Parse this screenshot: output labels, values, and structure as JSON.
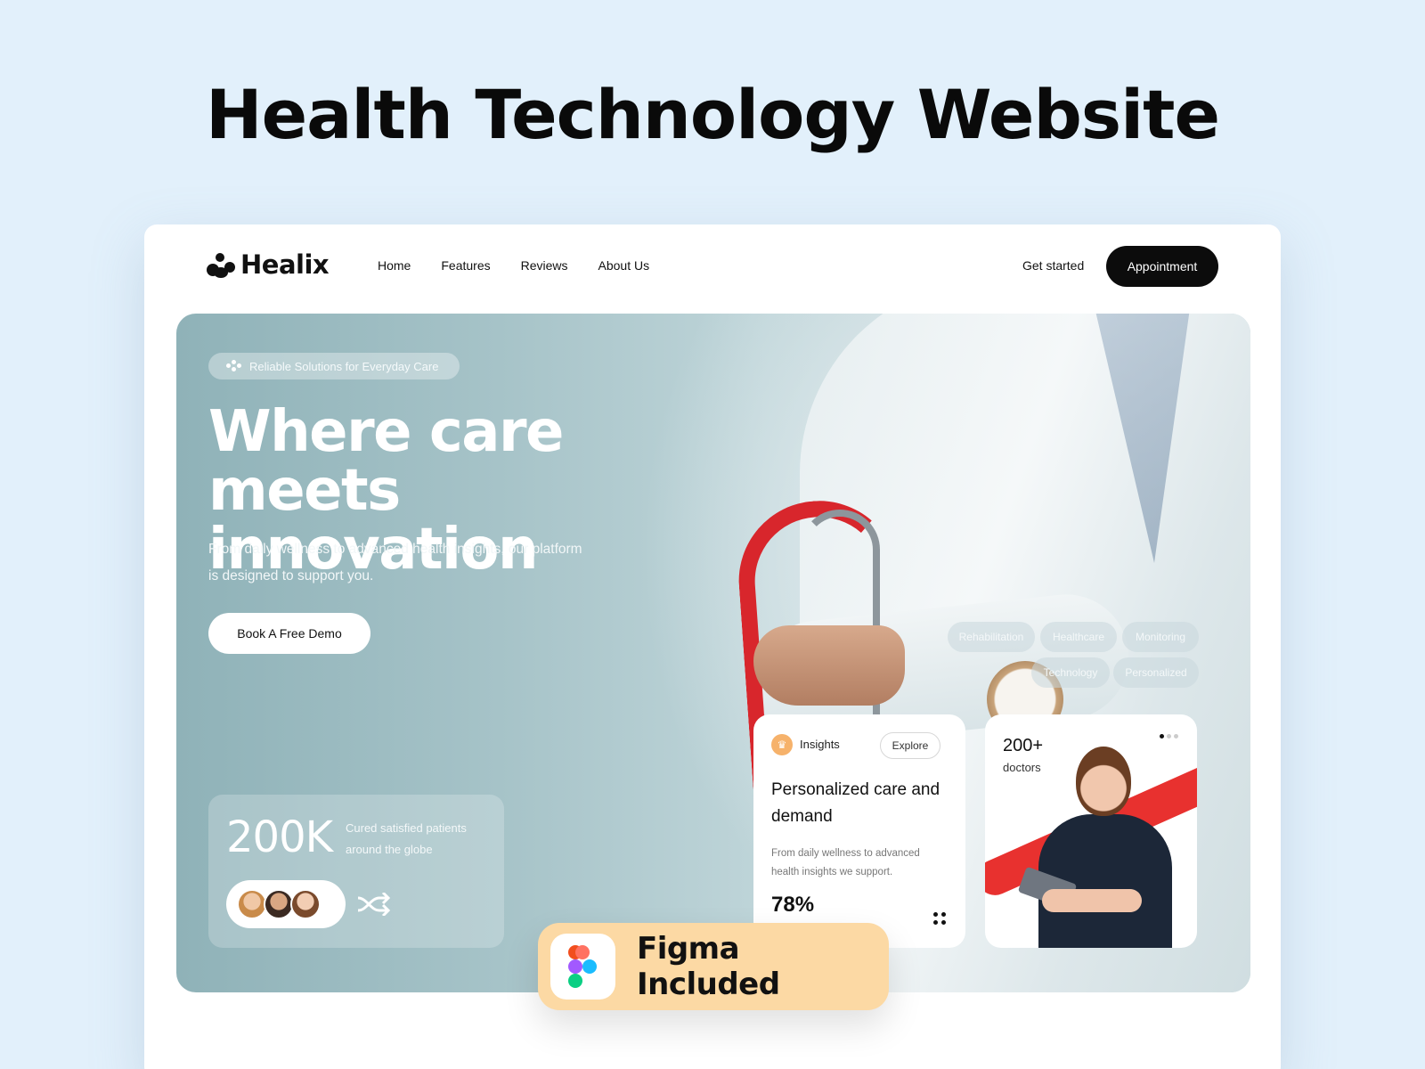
{
  "page": {
    "heading": "Health Technology Website"
  },
  "nav": {
    "brand": "Healix",
    "links": [
      "Home",
      "Features",
      "Reviews",
      "About Us"
    ],
    "get_started": "Get started",
    "appointment": "Appointment"
  },
  "hero": {
    "tagline": "Reliable Solutions for Everyday Care",
    "title_line1": "Where care",
    "title_line2": "meets innovation",
    "subtitle": "From daily wellness to advanced health insights, our platform is designed to support you.",
    "cta": "Book A Free Demo"
  },
  "stats": {
    "value": "200K",
    "description": "Cured satisfied patients around the globe"
  },
  "tags": [
    "Rehabilitation",
    "Healthcare",
    "Monitoring",
    "Technology",
    "Personalized"
  ],
  "insights_card": {
    "label": "Insights",
    "explore": "Explore",
    "title": "Personalized care and demand",
    "text": "From daily wellness to advanced health insights we support.",
    "percent": "78%"
  },
  "doctors_card": {
    "count": "200+",
    "label": "doctors"
  },
  "badge": {
    "text": "Figma Included"
  },
  "colors": {
    "background": "#e2f0fb",
    "accent_dark": "#0c0c0c",
    "badge": "#fcd9a4",
    "swoosh_red": "#e8312f"
  }
}
